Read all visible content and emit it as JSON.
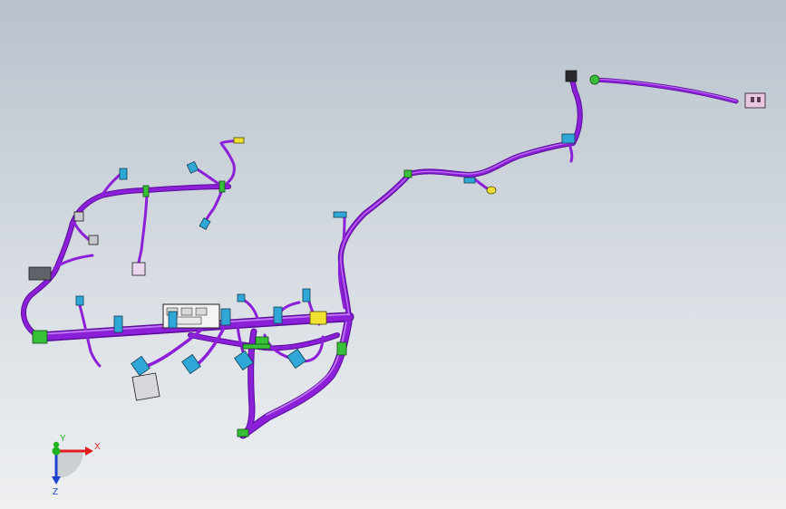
{
  "view": {
    "background_top": "#b9c2cc",
    "background_bottom": "#eef0f2"
  },
  "colors": {
    "harness": "#8c1fd8",
    "harness_highlight": "#c070ff",
    "harness_shadow": "#5a0c9a",
    "connector_blue": "#2fa8d8",
    "connector_green": "#38c038",
    "connector_yellow": "#f0e030",
    "connector_gray": "#606268",
    "connector_pink": "#e8c6e0",
    "fuse_box": "#f4f4f4"
  },
  "triad": {
    "x_label": "X",
    "y_label": "Y",
    "z_label": "Z",
    "x_color": "#e02020",
    "y_color": "#20b020",
    "z_color": "#2040d0"
  }
}
